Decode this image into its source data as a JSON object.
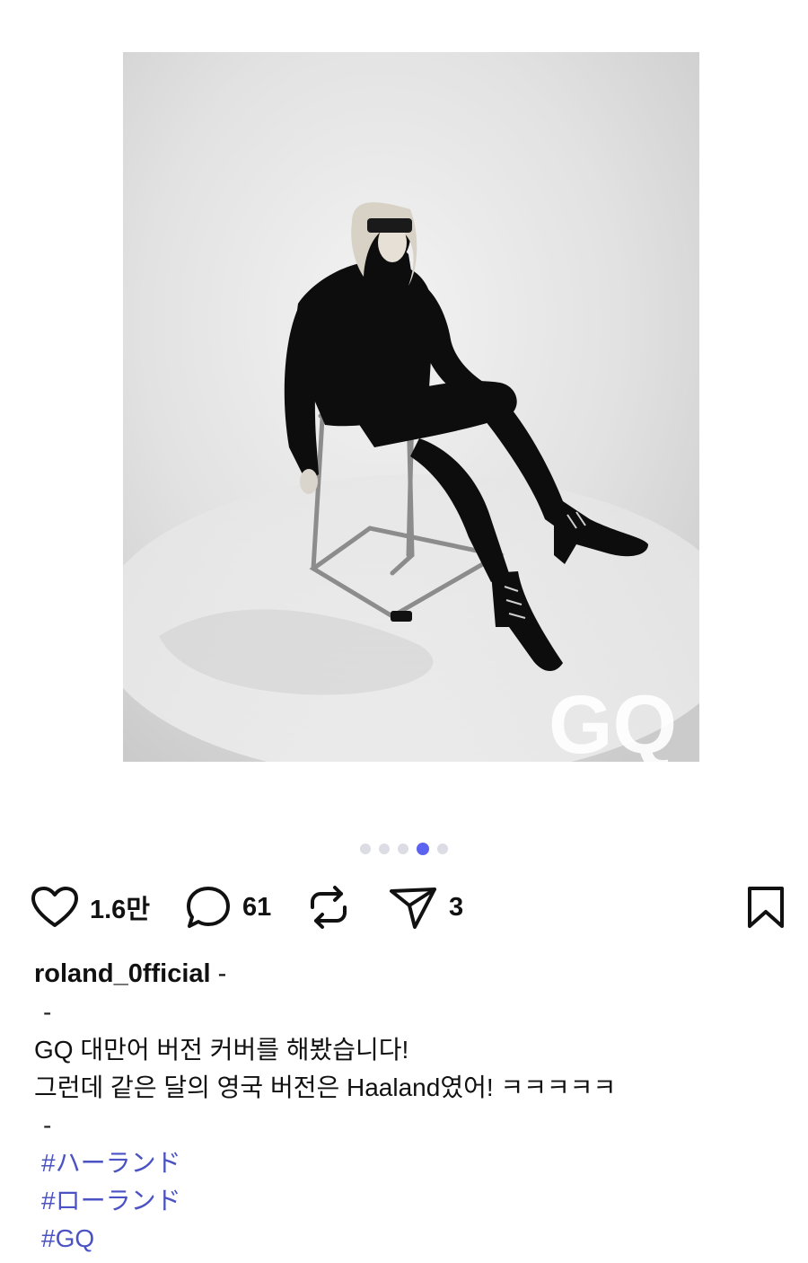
{
  "post": {
    "image": {
      "alt": "",
      "watermark": "GQ"
    },
    "carousel": {
      "total": 5,
      "active_index": 3,
      "active_color": "#5b63f0",
      "inactive_color": "#dcdce4"
    },
    "actions": {
      "like": {
        "icon": "heart-icon",
        "count": "1.6만"
      },
      "comment": {
        "icon": "comment-bubble-icon",
        "count": "61"
      },
      "repost": {
        "icon": "repost-icon",
        "count": ""
      },
      "share": {
        "icon": "send-icon",
        "count": "3"
      },
      "bookmark": {
        "icon": "bookmark-icon"
      }
    },
    "caption": {
      "username": "roland_0fficial",
      "username_suffix": " -",
      "line_dash_1": "-",
      "line_1": "GQ 대만어 버전 커버를 해봤습니다!",
      "line_2": "그런데 같은 달의 영국 버전은 Haaland였어! ㅋㅋㅋㅋㅋ",
      "line_dash_2": "-",
      "hashtags": [
        "#ハーランド",
        "#ローランド",
        "#GQ"
      ],
      "hashtag_color": "#4a52c4"
    }
  }
}
